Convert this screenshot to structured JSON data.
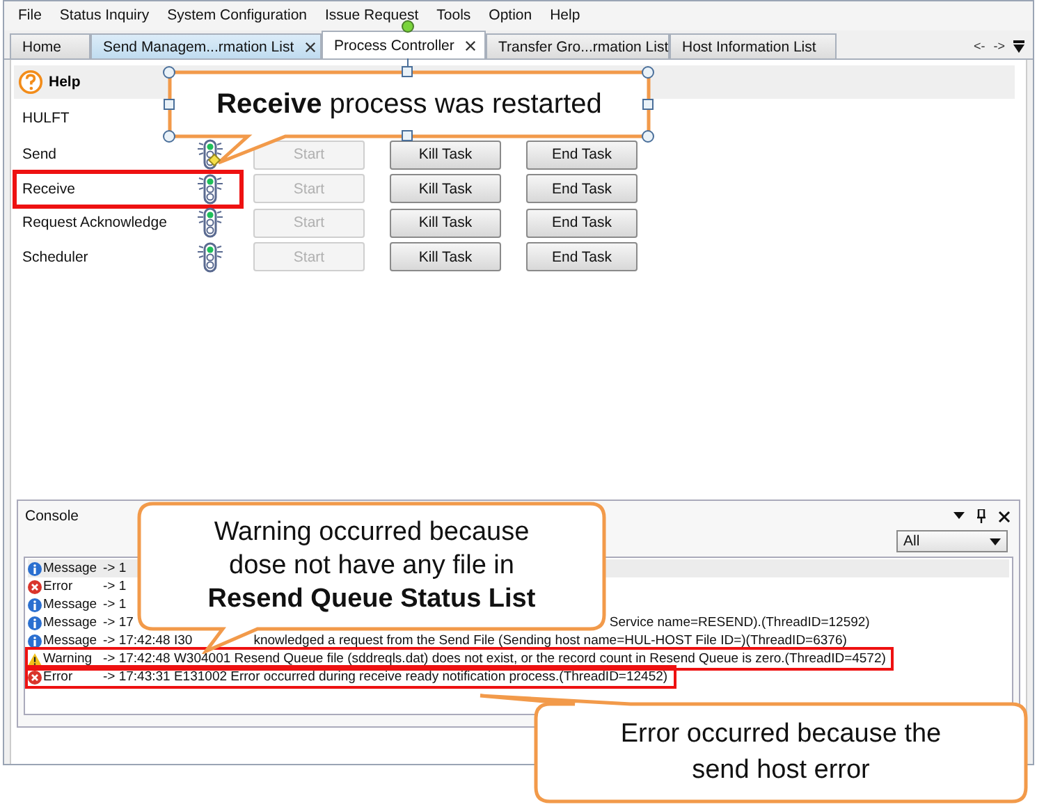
{
  "menu": [
    "File",
    "Status Inquiry",
    "System Configuration",
    "Issue Request",
    "Tools",
    "Option",
    "Help"
  ],
  "tabs": [
    {
      "label": "Home",
      "selected": false,
      "closable": false
    },
    {
      "label": "Send Managem...rmation List",
      "selected": false,
      "closable": true
    },
    {
      "label": "Process Controller",
      "selected": true,
      "closable": true
    },
    {
      "label": "Transfer Gro...rmation List",
      "selected": false,
      "closable": false
    },
    {
      "label": "Host Information List",
      "selected": false,
      "closable": false
    }
  ],
  "tab_nav": [
    "<-",
    "->"
  ],
  "toolbar": {
    "help": "Help"
  },
  "group": "HULFT",
  "processes": [
    {
      "name": "Send",
      "start": "Start",
      "start_disabled": true,
      "kill": "Kill Task",
      "end": "End Task",
      "highlighted": false
    },
    {
      "name": "Receive",
      "start": "Start",
      "start_disabled": true,
      "kill": "Kill Task",
      "end": "End Task",
      "highlighted": true
    },
    {
      "name": "Request Acknowledge",
      "start": "Start",
      "start_disabled": true,
      "kill": "Kill Task",
      "end": "End Task",
      "highlighted": false
    },
    {
      "name": "Scheduler",
      "start": "Start",
      "start_disabled": true,
      "kill": "Kill Task",
      "end": "End Task",
      "highlighted": false
    }
  ],
  "console": {
    "title": "Console",
    "filter": "All",
    "lines": [
      {
        "kind": "info",
        "type": "Message",
        "text": "-> 1",
        "highlighted": false,
        "selected": true
      },
      {
        "kind": "error",
        "type": "Error",
        "text": "-> 1",
        "highlighted": false,
        "selected": false
      },
      {
        "kind": "info",
        "type": "Message",
        "text": "-> 1",
        "highlighted": false,
        "selected": false
      },
      {
        "kind": "info",
        "type": "Message",
        "text": "-> 17",
        "rest": "Service name=RESEND).(ThreadID=12592)",
        "highlighted": false,
        "selected": false
      },
      {
        "kind": "info",
        "type": "Message",
        "text": "-> 17:42:48 I30",
        "rest": "knowledged a request from the Send File (Sending host name=HUL-HOST File ID=)(ThreadID=6376)",
        "highlighted": false,
        "selected": false
      },
      {
        "kind": "warning",
        "type": "Warning",
        "text": "-> 17:42:48 W304001 Resend Queue file (sddreqls.dat) does not exist, or the record count in Resend Queue is zero.(ThreadID=4572)",
        "highlighted": true,
        "selected": false
      },
      {
        "kind": "error",
        "type": "Error",
        "text": "-> 17:43:31 E131002 Error occurred during receive ready notification process.(ThreadID=12452)",
        "highlighted": true,
        "selected": false
      }
    ]
  },
  "callouts": [
    {
      "kind": "top",
      "text": "**Receive** process was restarted",
      "selected": true
    },
    {
      "kind": "middle",
      "text": "Warning occurred because dose not have any file in **Resend Queue Status List**",
      "selected": false
    },
    {
      "kind": "bottom",
      "text": "Error occurred because the send host error",
      "selected": false
    }
  ]
}
